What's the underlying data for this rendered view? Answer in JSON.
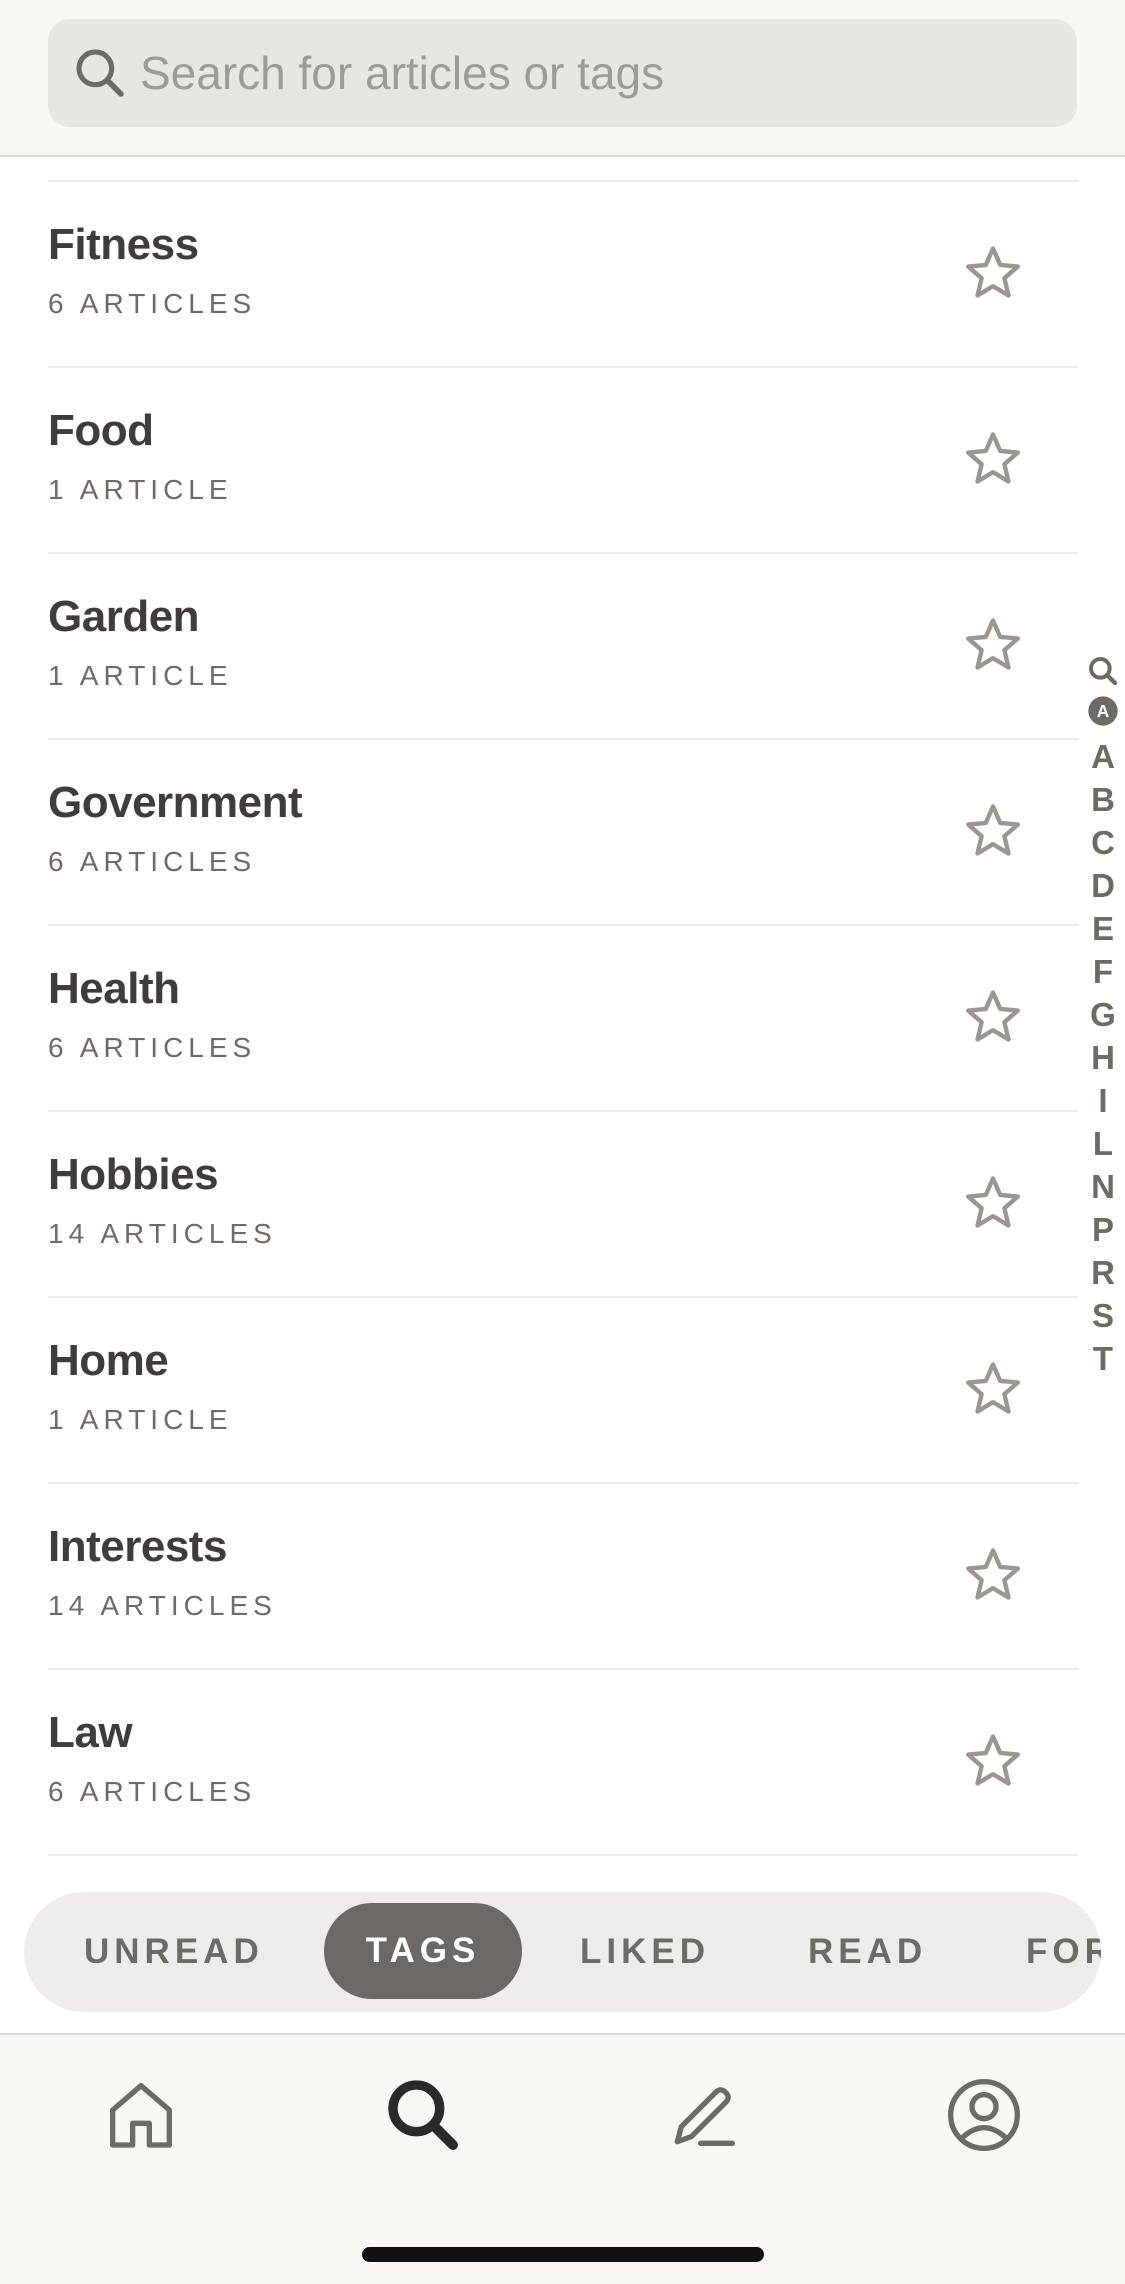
{
  "search": {
    "placeholder": "Search for articles or tags",
    "icon": "search-icon"
  },
  "tags": [
    {
      "name": "Fitness",
      "count": "6 ARTICLES"
    },
    {
      "name": "Food",
      "count": "1 ARTICLE"
    },
    {
      "name": "Garden",
      "count": "1 ARTICLE"
    },
    {
      "name": "Government",
      "count": "6 ARTICLES"
    },
    {
      "name": "Health",
      "count": "6 ARTICLES"
    },
    {
      "name": "Hobbies",
      "count": "14 ARTICLES"
    },
    {
      "name": "Home",
      "count": "1 ARTICLE"
    },
    {
      "name": "Interests",
      "count": "14 ARTICLES"
    },
    {
      "name": "Law",
      "count": "6 ARTICLES"
    }
  ],
  "index": {
    "icons": [
      "search-icon",
      "a-circle-icon"
    ],
    "letters": [
      "A",
      "B",
      "C",
      "D",
      "E",
      "F",
      "G",
      "H",
      "I",
      "L",
      "N",
      "P",
      "R",
      "S",
      "T"
    ]
  },
  "tabs": [
    {
      "label": "UNREAD"
    },
    {
      "label": "TAGS",
      "active": true
    },
    {
      "label": "LIKED"
    },
    {
      "label": "READ"
    },
    {
      "label": "FOR"
    }
  ],
  "bottom_nav": [
    "home-icon",
    "search-icon",
    "pen-icon",
    "profile-icon"
  ],
  "colors": {
    "text": "#3f3d3b",
    "muted": "#6e6b67",
    "star": "#9a9793",
    "active_tab": "#6b6865",
    "bar_bg": "#f8f7f4"
  }
}
